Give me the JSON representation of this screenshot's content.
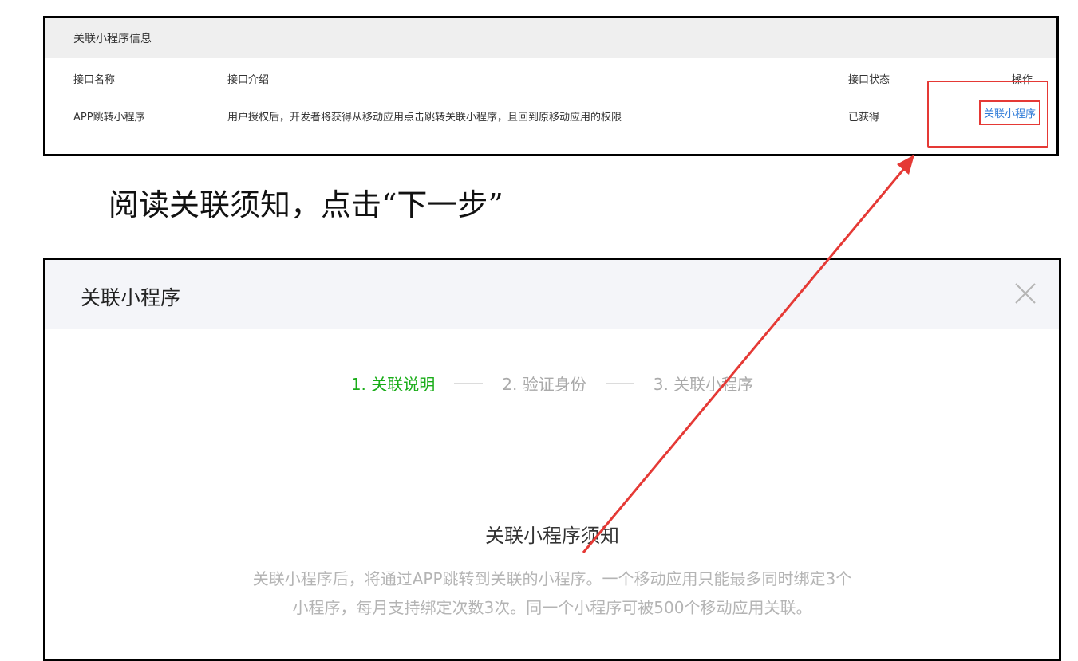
{
  "top_panel": {
    "header": "关联小程序信息",
    "columns": [
      "接口名称",
      "接口介绍",
      "接口状态",
      "操作"
    ],
    "row": {
      "name": "APP跳转小程序",
      "description": "用户授权后，开发者将获得从移动应用点击跳转关联小程序，且回到原移动应用的权限",
      "status": "已获得",
      "action": "关联小程序"
    }
  },
  "instruction": "阅读关联须知，点击“下一步”",
  "modal": {
    "title": "关联小程序",
    "close_icon": "close-icon",
    "steps": [
      "1. 关联说明",
      "2. 验证身份",
      "3. 关联小程序"
    ],
    "active_step": 0,
    "notice_title": "关联小程序须知",
    "notice_lines": [
      "关联小程序后，将通过APP跳转到关联的小程序。一个移动应用只能最多同时绑定3个",
      "小程序，每月支持绑定次数3次。同一个小程序可被500个移动应用关联。"
    ]
  },
  "colors": {
    "accent_green": "#1aad19",
    "link_blue": "#2f7bd8",
    "annotation_red": "#e53935"
  }
}
